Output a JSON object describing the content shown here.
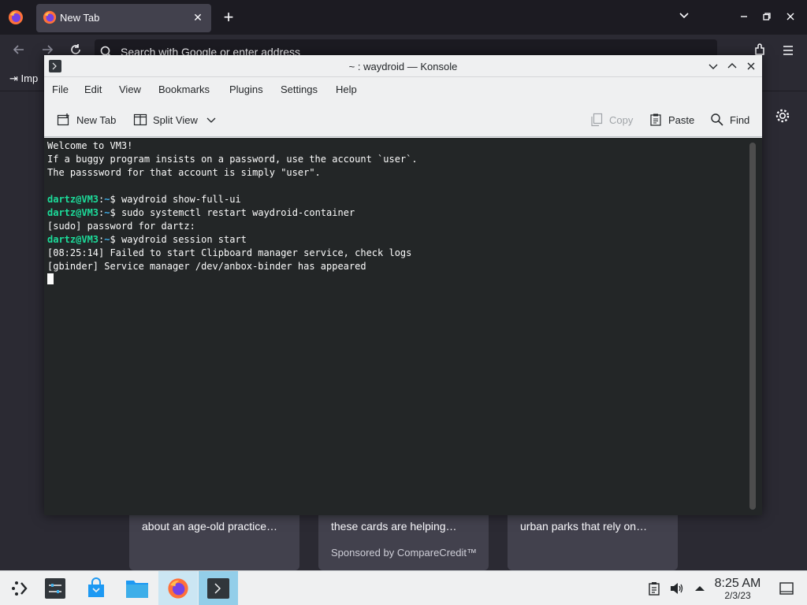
{
  "firefox": {
    "tab_title": "New Tab",
    "url_placeholder": "Search with Google or enter address",
    "bookmark_import_label": "Imp",
    "stories": [
      {
        "text": "about an age-old practice…",
        "sponsor": ""
      },
      {
        "text": "these cards are helping…",
        "sponsor": "Sponsored by CompareCredit™"
      },
      {
        "text": "urban parks that rely on…",
        "sponsor": ""
      }
    ]
  },
  "konsole": {
    "title": "~ : waydroid — Konsole",
    "menu": [
      "File",
      "Edit",
      "View",
      "Bookmarks",
      "Plugins",
      "Settings",
      "Help"
    ],
    "toolbar": {
      "new_tab": "New Tab",
      "split_view": "Split View",
      "copy": "Copy",
      "paste": "Paste",
      "find": "Find"
    },
    "terminal": {
      "user_host": "dartz@VM3",
      "path_sep": ":",
      "path": "~",
      "prompt_char": "$ ",
      "lines": [
        {
          "type": "out",
          "text": "Welcome to VM3!"
        },
        {
          "type": "out",
          "text": "If a buggy program insists on a password, use the account `user`."
        },
        {
          "type": "out",
          "text": "The passsword for that account is simply \"user\"."
        },
        {
          "type": "out",
          "text": ""
        },
        {
          "type": "cmd",
          "text": "waydroid show-full-ui"
        },
        {
          "type": "cmd",
          "text": "sudo systemctl restart waydroid-container"
        },
        {
          "type": "out",
          "text": "[sudo] password for dartz:"
        },
        {
          "type": "cmd",
          "text": "waydroid session start"
        },
        {
          "type": "out",
          "text": "[08:25:14] Failed to start Clipboard manager service, check logs"
        },
        {
          "type": "out",
          "text": "[gbinder] Service manager /dev/anbox-binder has appeared"
        }
      ]
    }
  },
  "panel": {
    "time": "8:25 AM",
    "date": "2/3/23"
  },
  "colors": {
    "terminal_bg": "#232627",
    "prompt_user": "#1cdc9a",
    "prompt_path": "#3daee9",
    "panel_active": "#93cee9",
    "firefox_bg": "#2b2a33"
  }
}
